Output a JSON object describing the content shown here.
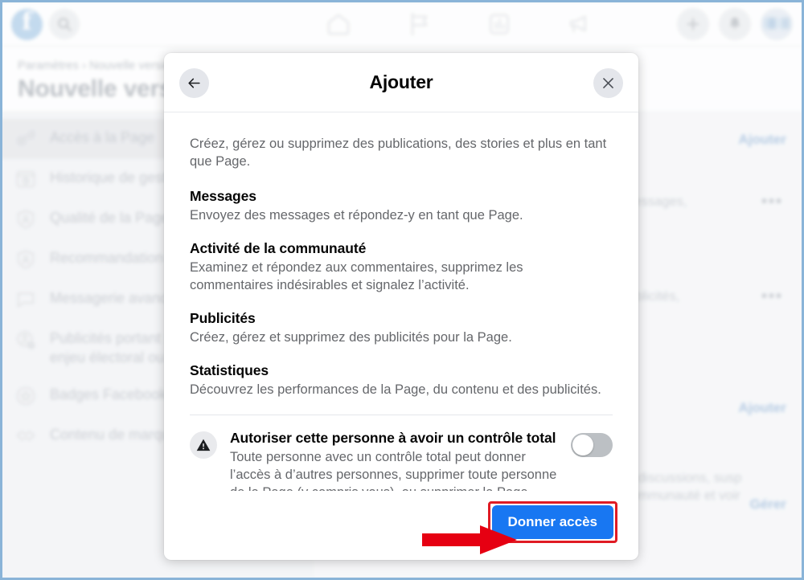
{
  "topbar": {
    "logo_letter": "f",
    "logo_name": "facebook-logo",
    "search_icon": "search-icon",
    "nav_icons": [
      {
        "name": "home-icon",
        "label": "Accueil"
      },
      {
        "name": "pages-flag-icon",
        "label": "Pages"
      },
      {
        "name": "insights-chart-icon",
        "label": "Statistiques"
      },
      {
        "name": "megaphone-ads-icon",
        "label": "Publicités"
      }
    ],
    "create_icon": "plus-icon",
    "notifications_icon": "bell-icon",
    "avatar": "avatar"
  },
  "page_header": {
    "breadcrumb": "Paramètres › Nouvelle version",
    "title": "Nouvelle version"
  },
  "sidebar": {
    "items": [
      {
        "label": "Accès à la Page",
        "icon": "key-icon",
        "active": true
      },
      {
        "label": "Historique de gestion",
        "icon": "history-icon",
        "active": false
      },
      {
        "label": "Qualité de la Page",
        "icon": "shield-person-icon",
        "active": false
      },
      {
        "label": "Recommandation",
        "icon": "shield-person-icon",
        "active": false
      },
      {
        "label": "Messagerie avancée",
        "icon": "chat-bubble-icon",
        "active": false
      },
      {
        "label": "Publicités portant sur un enjeu électoral ou politique",
        "icon": "ads-settings-icon",
        "active": false
      },
      {
        "label": "Badges Facebook",
        "icon": "star-badge-icon",
        "active": false
      },
      {
        "label": "Contenu de marque",
        "icon": "handshake-icon",
        "active": false
      }
    ]
  },
  "background_panel": {
    "rows": [
      {
        "link": "Ajouter",
        "dots": "",
        "text": ""
      },
      {
        "link": "",
        "dots": "•••",
        "text": "enu, Messages,\ntiques"
      },
      {
        "link": "",
        "dots": "•••",
        "text": "uté, Publicités,"
      },
      {
        "link": "Ajouter",
        "dots": "",
        "text": ""
      },
      {
        "link": "Gérer",
        "dots": "",
        "text": "ntaires des discussions, susp\nrds de la communauté et voir"
      }
    ]
  },
  "modal": {
    "title": "Ajouter",
    "back_icon": "back-arrow-icon",
    "close_icon": "close-icon",
    "intro": "Créez, gérez ou supprimez des publications, des stories et plus en tant que Page.",
    "permissions": [
      {
        "title": "Messages",
        "description": "Envoyez des messages et répondez-y en tant que Page."
      },
      {
        "title": "Activité de la communauté",
        "description": "Examinez et répondez aux commentaires, supprimez les commentaires indésirables et signalez l’activité."
      },
      {
        "title": "Publicités",
        "description": "Créez, gérez et supprimez des publicités pour la Page."
      },
      {
        "title": "Statistiques",
        "description": "Découvrez les performances de la Page, du contenu et des publicités."
      }
    ],
    "full_control": {
      "warning_icon": "warning-triangle-icon",
      "title": "Autoriser cette personne à avoir un contrôle total",
      "description": "Toute personne avec un contrôle total peut donner l’accès à d’autres personnes, supprimer toute personne de la Page (y compris vous), ou supprimer la Page",
      "toggle_state": "off"
    },
    "primary_button": "Donner accès"
  },
  "annotation": {
    "arrow": "red-arrow-pointing-right",
    "highlight_color": "#e01b24"
  },
  "colors": {
    "brand_blue": "#1877f2",
    "annotation_red": "#e01b24",
    "toggle_off": "#bcc0c4",
    "modal_bg": "#ffffff",
    "page_bg": "#f0f2f5"
  }
}
